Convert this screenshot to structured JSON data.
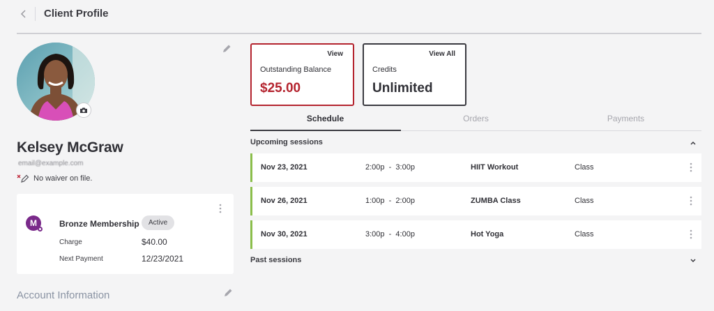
{
  "header": {
    "title": "Client Profile"
  },
  "profile": {
    "name": "Kelsey McGraw",
    "email": "email@example.com",
    "waiver": "No waiver on file."
  },
  "membership": {
    "logo_letter": "M",
    "name": "Bronze Membership",
    "status": "Active",
    "charge_label": "Charge",
    "charge_value": "$40.00",
    "next_label": "Next Payment",
    "next_value": "12/23/2021"
  },
  "account_info_label": "Account Information",
  "summary": {
    "balance": {
      "link": "View",
      "label": "Outstanding Balance",
      "value": "$25.00"
    },
    "credits": {
      "link": "View All",
      "label": "Credits",
      "value": "Unlimited"
    }
  },
  "tabs": [
    {
      "label": "Schedule"
    },
    {
      "label": "Orders"
    },
    {
      "label": "Payments"
    }
  ],
  "upcoming_label": "Upcoming sessions",
  "past_label": "Past sessions",
  "sessions": [
    {
      "date": "Nov 23, 2021",
      "time": "2:00p  -  3:00p",
      "name": "HIIT Workout",
      "type": "Class"
    },
    {
      "date": "Nov 26, 2021",
      "time": "1:00p  -  2:00p",
      "name": "ZUMBA Class",
      "type": "Class"
    },
    {
      "date": "Nov 30, 2021",
      "time": "3:00p  -  4:00p",
      "name": "Hot Yoga",
      "type": "Class"
    }
  ],
  "colors": {
    "balance_accent": "#b4232e",
    "session_accent": "#8bbe4b",
    "brand": "#7a2a8a"
  }
}
